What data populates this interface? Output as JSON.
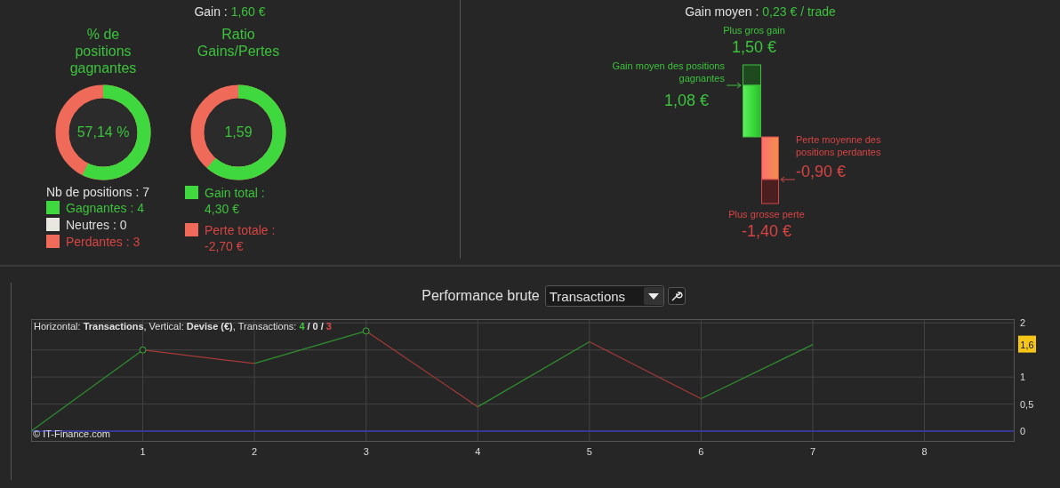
{
  "gain_summary": {
    "label": "Gain :",
    "value": "1,60 €"
  },
  "win_rate": {
    "title": "% de positions gagnantes",
    "center": "57,14 %",
    "total_label": "Nb de positions : 7",
    "level": 0.5714,
    "legend": [
      {
        "label": "Gagnantes : 4",
        "color": "#3fd93f"
      },
      {
        "label": "Neutres : 0",
        "color": "#e8e8e0"
      },
      {
        "label": "Perdantes : 3",
        "color": "#f06a5a"
      }
    ]
  },
  "ratio": {
    "title": "Ratio Gains/Pertes",
    "center": "1,59",
    "level": 0.6143,
    "legend": [
      {
        "label": "Gain total : 4,30 €",
        "color": "#3fd93f"
      },
      {
        "label": "Perte totale : -2,70 €",
        "color": "#f06a5a"
      }
    ]
  },
  "average": {
    "label": "Gain moyen :",
    "value": "0,23 € / trade",
    "biggest_gain_label": "Plus gros gain",
    "biggest_gain": "1,50 €",
    "avg_gain_label": "Gain moyen des positions gagnantes",
    "avg_gain": "1,08 €",
    "avg_loss_label": "Perte moyenne des positions perdantes",
    "avg_loss": "-0,90 €",
    "biggest_loss_label": "Plus grosse perte",
    "biggest_loss": "-1,40 €"
  },
  "performance": {
    "title": "Performance brute",
    "mode": "Transactions",
    "caption": "Horizontal: **Transactions**, Vertical: **Devise (€)**, Transactions:",
    "counts": [
      {
        "value": "4",
        "color": "#3fc43f"
      },
      {
        "value": "0",
        "color": "#e0e0e0"
      },
      {
        "value": "3",
        "color": "#e04848"
      }
    ],
    "count_separator": "/",
    "last_value_badge": "1,6",
    "copyright": "© IT-Finance.com",
    "chart_data": {
      "type": "line",
      "x": [
        0,
        1,
        2,
        3,
        4,
        5,
        6,
        7
      ],
      "series": [
        {
          "color": "#2f8f2f",
          "values": [
            0,
            1.5,
            null,
            null,
            null,
            null,
            null,
            null
          ]
        },
        {
          "color": "#a83a3a",
          "values": [
            null,
            1.5,
            1.25,
            null,
            null,
            null,
            null,
            null
          ]
        },
        {
          "color": "#2f8f2f",
          "values": [
            null,
            null,
            1.25,
            1.85,
            null,
            null,
            null,
            null
          ]
        },
        {
          "color": "#a83a3a",
          "values": [
            null,
            null,
            null,
            1.85,
            0.45,
            null,
            null,
            null
          ]
        },
        {
          "color": "#2f8f2f",
          "values": [
            null,
            null,
            null,
            null,
            0.45,
            1.65,
            null,
            null
          ]
        },
        {
          "color": "#a83a3a",
          "values": [
            null,
            null,
            null,
            null,
            null,
            1.65,
            0.6,
            null
          ]
        },
        {
          "color": "#2f8f2f",
          "values": [
            null,
            null,
            null,
            null,
            null,
            null,
            0.6,
            1.6
          ]
        }
      ],
      "xlim": [
        0,
        8.8
      ],
      "ylim": [
        -0.18,
        2.07
      ],
      "grid": true,
      "ref_lines": [
        {
          "axis": "y",
          "value": 0,
          "color": "#3a3ab0"
        }
      ],
      "xticks": [
        1,
        2,
        3,
        4,
        5,
        6,
        7,
        8
      ],
      "yticks": [
        {
          "value": 0,
          "label": "0"
        },
        {
          "value": 0.5,
          "label": "0,5"
        },
        {
          "value": 1,
          "label": "1"
        },
        {
          "value": 2,
          "label": "2"
        }
      ]
    }
  }
}
